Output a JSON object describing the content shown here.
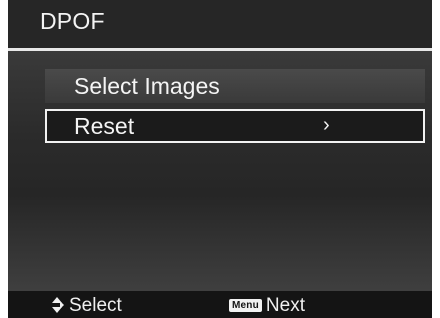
{
  "header": {
    "title": "DPOF"
  },
  "menu": {
    "items": [
      {
        "label": "Select Images",
        "selected": false
      },
      {
        "label": "Reset",
        "selected": true,
        "chevron": "›"
      }
    ]
  },
  "footer": {
    "select_icon": "up-down-arrows-icon",
    "select_label": "Select",
    "next_key": "Menu",
    "next_label": "Next"
  },
  "colors": {
    "background": "#1f1f1f",
    "text": "#f4f4f4",
    "highlight_border": "#f2f2f2"
  }
}
